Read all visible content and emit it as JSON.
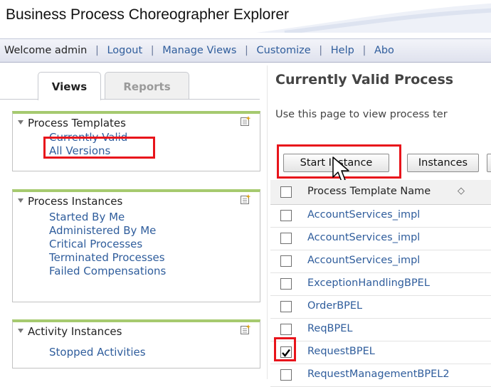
{
  "app": {
    "title": "Business Process Choreographer Explorer"
  },
  "nav": {
    "welcome": "Welcome admin",
    "links": [
      "Logout",
      "Manage Views",
      "Customize",
      "Help",
      "Abo"
    ]
  },
  "tabs": {
    "views": "Views",
    "reports": "Reports"
  },
  "panels": {
    "templates": {
      "title": "Process Templates",
      "items": [
        "Currently Valid",
        "All Versions"
      ]
    },
    "instances": {
      "title": "Process Instances",
      "items": [
        "Started By Me",
        "Administered By Me",
        "Critical Processes",
        "Terminated Processes",
        "Failed Compensations"
      ]
    },
    "activities": {
      "title": "Activity Instances",
      "items": [
        "Stopped Activities"
      ]
    }
  },
  "main": {
    "title": "Currently Valid Process",
    "description": "Use this page to view process ter",
    "buttons": {
      "start": "Start Instance",
      "instances": "Instances"
    },
    "table": {
      "header": "Process Template Name",
      "rows": [
        {
          "name": "AccountServices_impl",
          "checked": false
        },
        {
          "name": "AccountServices_impl",
          "checked": false
        },
        {
          "name": "AccountServices_impl",
          "checked": false
        },
        {
          "name": "ExceptionHandlingBPEL",
          "checked": false
        },
        {
          "name": "OrderBPEL",
          "checked": false
        },
        {
          "name": "ReqBPEL",
          "checked": false
        },
        {
          "name": "RequestBPEL",
          "checked": true
        },
        {
          "name": "RequestManagementBPEL2",
          "checked": false
        }
      ]
    }
  },
  "colors": {
    "link": "#2f5d9c",
    "highlight": "#e8141b",
    "panel_accent": "#a6ca6f"
  },
  "icons": {
    "panel_config": "configure-icon",
    "collapse": "collapse-triangle-icon",
    "sort": "sort-icon",
    "cursor": "mouse-pointer-icon"
  }
}
